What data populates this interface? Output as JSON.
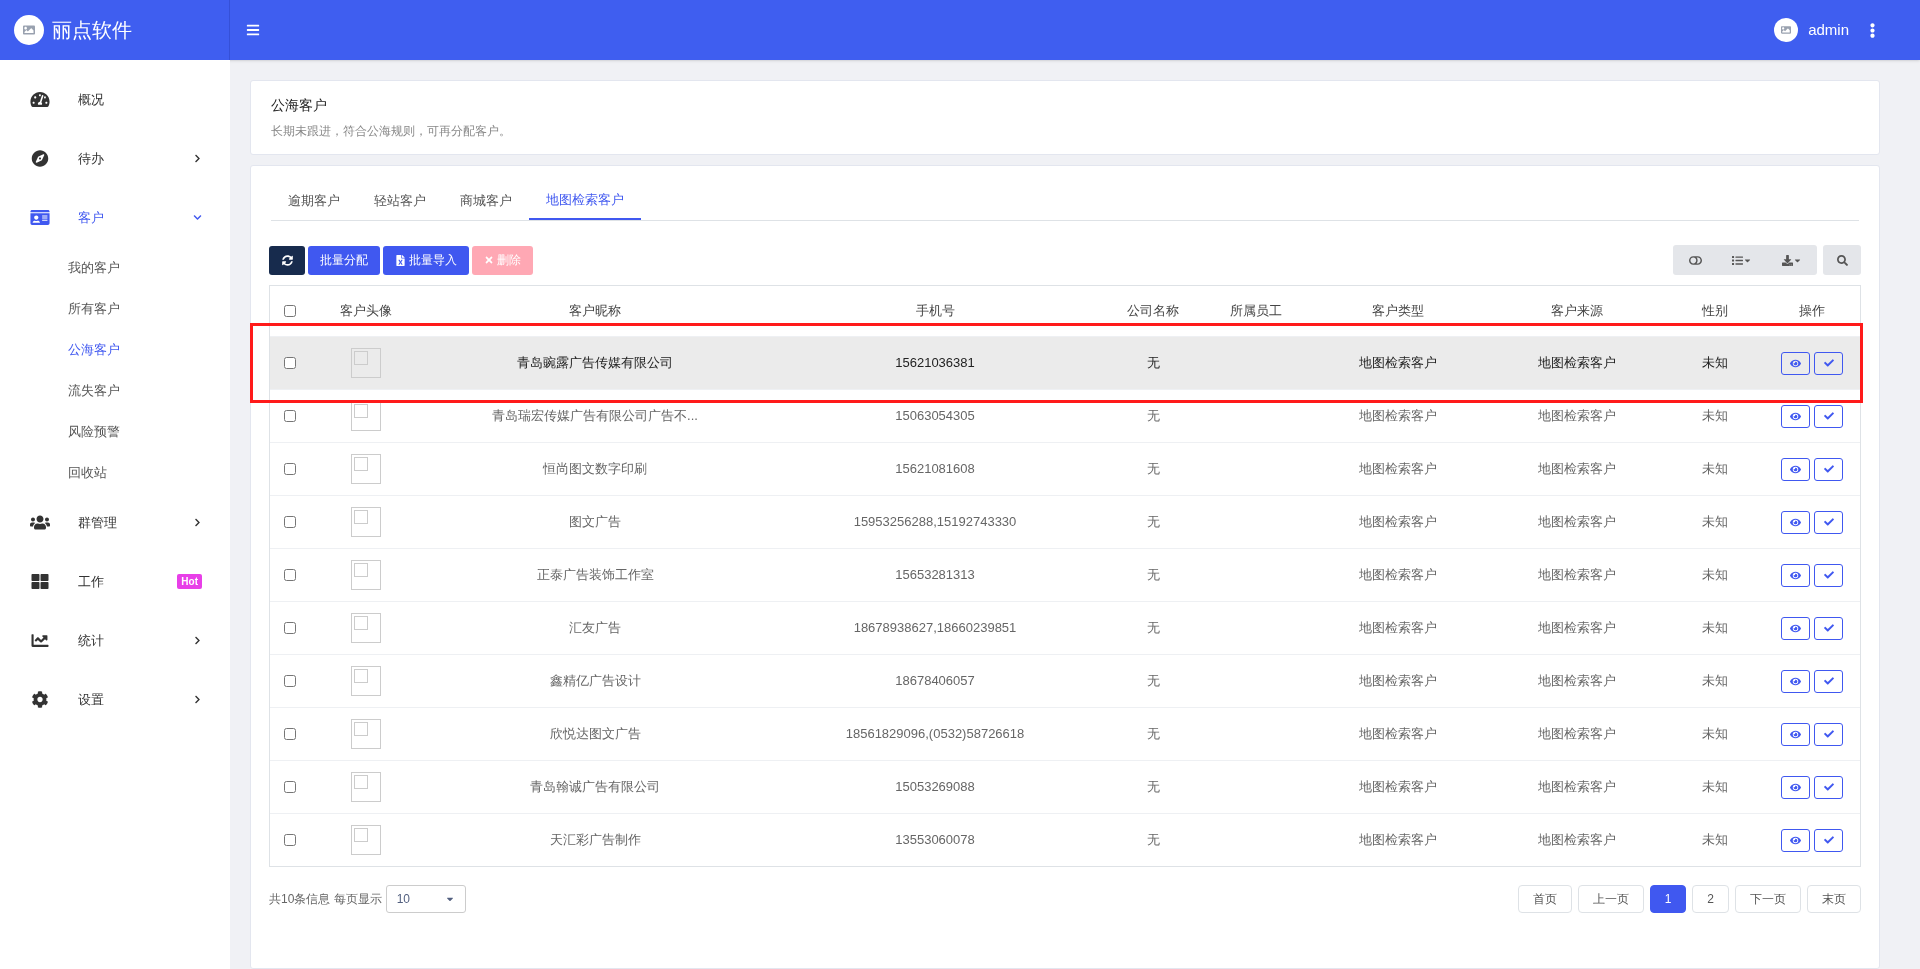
{
  "brand": {
    "name": "丽点软件"
  },
  "header": {
    "user": "admin"
  },
  "sidebar": {
    "items": [
      {
        "label": "概况",
        "selected": false
      },
      {
        "label": "待办",
        "expanded": false,
        "selected": false
      },
      {
        "label": "客户",
        "expanded": true,
        "selected": true,
        "children": [
          {
            "label": "我的客户",
            "selected": false
          },
          {
            "label": "所有客户",
            "selected": false
          },
          {
            "label": "公海客户",
            "selected": true
          },
          {
            "label": "流失客户",
            "selected": false
          },
          {
            "label": "风险预警",
            "selected": false
          },
          {
            "label": "回收站",
            "selected": false
          }
        ]
      },
      {
        "label": "群管理",
        "expanded": false,
        "selected": false
      },
      {
        "label": "工作",
        "selected": false,
        "badge": "Hot"
      },
      {
        "label": "统计",
        "expanded": false,
        "selected": false
      },
      {
        "label": "设置",
        "expanded": false,
        "selected": false
      }
    ]
  },
  "page": {
    "title": "公海客户",
    "description": "长期未跟进，符合公海规则，可再分配客户。"
  },
  "tabs": [
    {
      "label": "逾期客户",
      "selected": false
    },
    {
      "label": "轻站客户",
      "selected": false
    },
    {
      "label": "商城客户",
      "selected": false
    },
    {
      "label": "地图检索客户",
      "selected": true
    }
  ],
  "toolbar": {
    "buttons": [
      {
        "label": "批量分配",
        "kind": "primary",
        "disabled": false
      },
      {
        "label": "批量导入",
        "kind": "import",
        "disabled": false
      },
      {
        "label": "删除",
        "kind": "delete",
        "disabled": true
      }
    ]
  },
  "table": {
    "select_all_checked": false,
    "columns": [
      "客户头像",
      "客户昵称",
      "手机号",
      "公司名称",
      "所属员工",
      "客户类型",
      "客户来源",
      "性别",
      "操作"
    ],
    "rows": [
      {
        "checked": false,
        "highlighted": true,
        "name": "青岛豌露广告传媒有限公司",
        "phone": "15621036381",
        "company": "无",
        "staff": "",
        "type": "地图检索客户",
        "source": "地图检索客户",
        "gender": "未知"
      },
      {
        "checked": false,
        "highlighted": false,
        "name": "青岛瑞宏传媒广告有限公司广告不...",
        "phone": "15063054305",
        "company": "无",
        "staff": "",
        "type": "地图检索客户",
        "source": "地图检索客户",
        "gender": "未知"
      },
      {
        "checked": false,
        "highlighted": false,
        "name": "恒尚图文数字印刷",
        "phone": "15621081608",
        "company": "无",
        "staff": "",
        "type": "地图检索客户",
        "source": "地图检索客户",
        "gender": "未知"
      },
      {
        "checked": false,
        "highlighted": false,
        "name": "图文广告",
        "phone": "15953256288,15192743330",
        "company": "无",
        "staff": "",
        "type": "地图检索客户",
        "source": "地图检索客户",
        "gender": "未知"
      },
      {
        "checked": false,
        "highlighted": false,
        "name": "正泰广告装饰工作室",
        "phone": "15653281313",
        "company": "无",
        "staff": "",
        "type": "地图检索客户",
        "source": "地图检索客户",
        "gender": "未知"
      },
      {
        "checked": false,
        "highlighted": false,
        "name": "汇友广告",
        "phone": "18678938627,18660239851",
        "company": "无",
        "staff": "",
        "type": "地图检索客户",
        "source": "地图检索客户",
        "gender": "未知"
      },
      {
        "checked": false,
        "highlighted": false,
        "name": "鑫精亿广告设计",
        "phone": "18678406057",
        "company": "无",
        "staff": "",
        "type": "地图检索客户",
        "source": "地图检索客户",
        "gender": "未知"
      },
      {
        "checked": false,
        "highlighted": false,
        "name": "欣悦达图文广告",
        "phone": "18561829096,(0532)58726618",
        "company": "无",
        "staff": "",
        "type": "地图检索客户",
        "source": "地图检索客户",
        "gender": "未知"
      },
      {
        "checked": false,
        "highlighted": false,
        "name": "青岛翰诚广告有限公司",
        "phone": "15053269088",
        "company": "无",
        "staff": "",
        "type": "地图检索客户",
        "source": "地图检索客户",
        "gender": "未知"
      },
      {
        "checked": false,
        "highlighted": false,
        "name": "天汇彩广告制作",
        "phone": "13553060078",
        "company": "无",
        "staff": "",
        "type": "地图检索客户",
        "source": "地图检索客户",
        "gender": "未知"
      }
    ]
  },
  "footer": {
    "summary": "共10条信息 每页显示",
    "page_size": "10"
  },
  "pagination": [
    {
      "label": "首页",
      "selected": false
    },
    {
      "label": "上一页",
      "selected": false
    },
    {
      "label": "1",
      "selected": true
    },
    {
      "label": "2",
      "selected": false
    },
    {
      "label": "下一页",
      "selected": false
    },
    {
      "label": "末页",
      "selected": false
    }
  ]
}
